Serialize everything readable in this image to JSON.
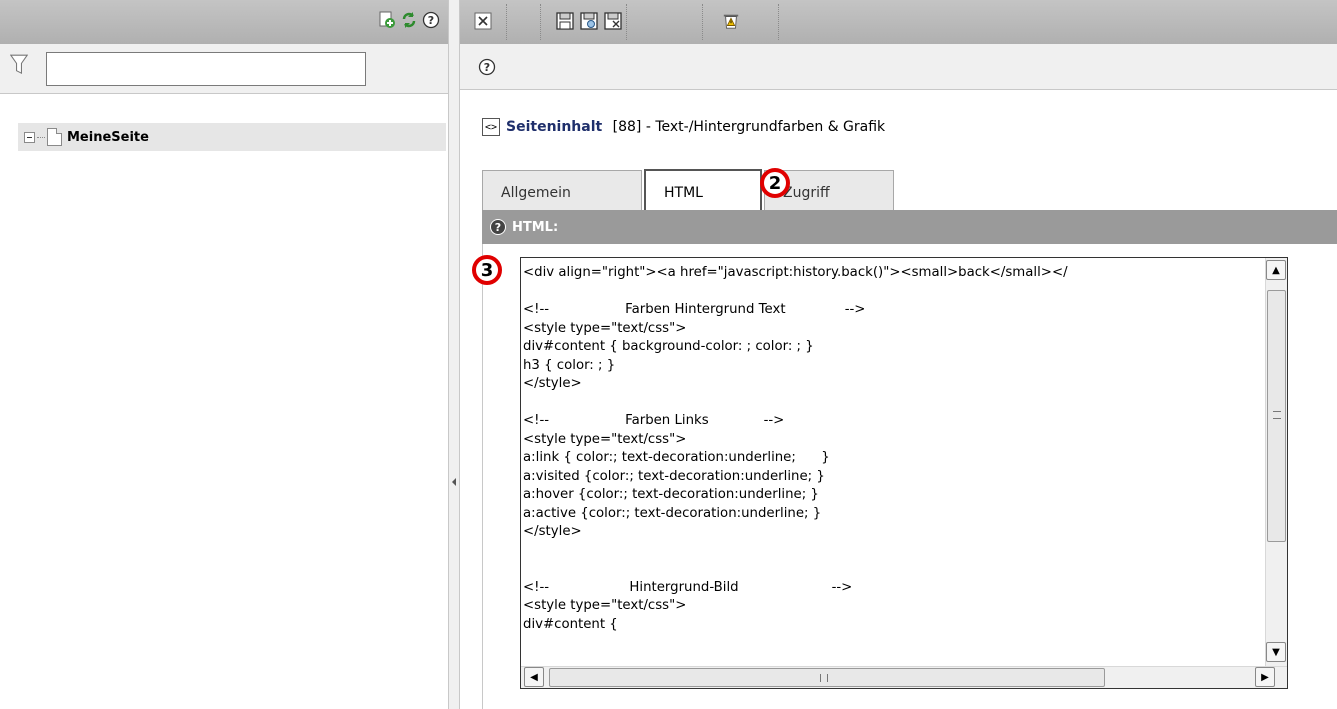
{
  "left": {
    "filter": {
      "value": "",
      "placeholder": ""
    },
    "tree": {
      "root_label": "MeineSeite"
    }
  },
  "right": {
    "content_title": {
      "strong": "Seiteninhalt",
      "rest": " [88] - Text-/Hintergrundfarben & Grafik"
    },
    "tabs": [
      {
        "label": "Allgemein",
        "active": false
      },
      {
        "label": "HTML",
        "active": true
      },
      {
        "label": "Zugriff",
        "active": false
      }
    ],
    "section_label": "HTML:",
    "code_lines": [
      "<div align=\"right\"><a href=\"javascript:history.back()\"><small>back</small></",
      "",
      "<!--                  Farben Hintergrund Text              -->",
      "<style type=\"text/css\">",
      "div#content { background-color: ; color: ; }",
      "h3 { color: ; }",
      "</style>",
      "",
      "<!--                  Farben Links             -->",
      "<style type=\"text/css\">",
      "a:link { color:; text-decoration:underline;      }",
      "a:visited {color:; text-decoration:underline; }",
      "a:hover {color:; text-decoration:underline; }",
      "a:active {color:; text-decoration:underline; }",
      "</style>",
      "",
      "",
      "<!--                   Hintergrund-Bild                      -->",
      "<style type=\"text/css\">",
      "div#content {"
    ],
    "markers": [
      "2",
      "3"
    ]
  },
  "icons": {
    "left_toolbar": [
      "new-page-icon",
      "refresh-icon",
      "help-icon"
    ],
    "right_toolbar": [
      "close-icon",
      "save-icon",
      "save-view-icon",
      "save-close-icon",
      "delete-icon"
    ]
  }
}
